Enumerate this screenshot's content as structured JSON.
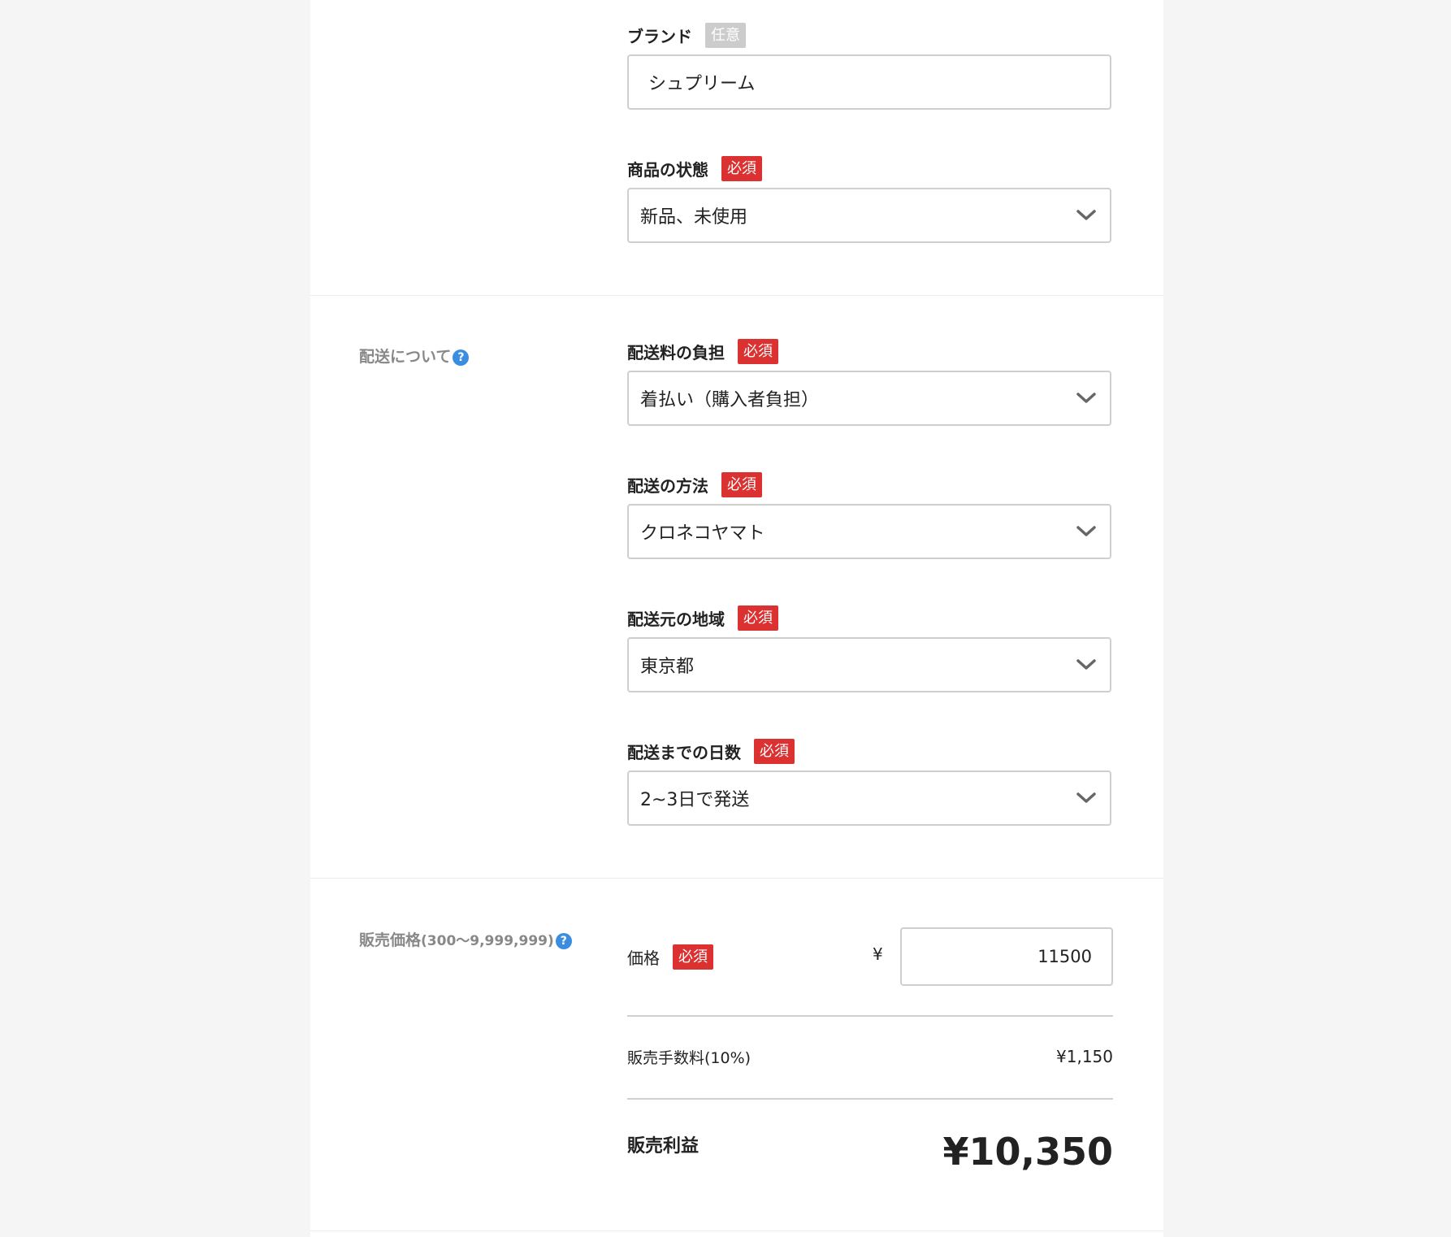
{
  "badges": {
    "required": "必須",
    "optional": "任意"
  },
  "brand": {
    "label": "ブランド",
    "value": "シュプリーム"
  },
  "condition": {
    "label": "商品の状態",
    "value": "新品、未使用"
  },
  "shipping_section": {
    "label": "配送について",
    "help_icon": "?"
  },
  "shipping_fee": {
    "label": "配送料の負担",
    "value": "着払い（購入者負担）"
  },
  "shipping_method": {
    "label": "配送の方法",
    "value": "クロネコヤマト"
  },
  "shipping_origin": {
    "label": "配送元の地域",
    "value": "東京都"
  },
  "shipping_days": {
    "label": "配送までの日数",
    "value": "2~3日で発送"
  },
  "price_section": {
    "label": "販売価格",
    "range": "(300〜9,999,999)",
    "help_icon": "?"
  },
  "price": {
    "label": "価格",
    "currency": "¥",
    "value": "11500"
  },
  "fee": {
    "label": "販売手数料(10%)",
    "value": "¥1,150"
  },
  "profit": {
    "label": "販売利益",
    "value": "¥10,350"
  },
  "colors": {
    "required_badge": "#db3131",
    "optional_badge": "#cccccc",
    "help_icon": "#3b8de0"
  },
  "icons": {
    "dropdown": "chevron-down-icon",
    "help": "help-icon"
  }
}
